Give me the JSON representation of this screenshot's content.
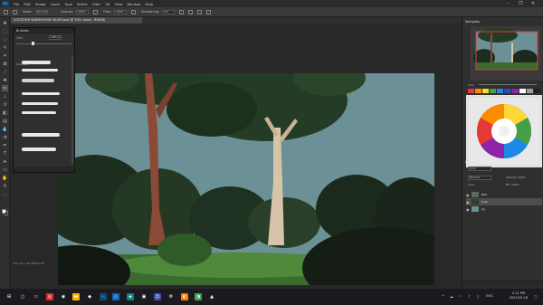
{
  "menubar": {
    "app_logo": "Ps",
    "items": [
      "File",
      "Edit",
      "Image",
      "Layer",
      "Type",
      "Select",
      "Filter",
      "3D",
      "View",
      "Window",
      "Help"
    ],
    "window_controls": {
      "minimize": "–",
      "maximize": "❐",
      "close": "✕"
    }
  },
  "options": {
    "mode_label": "Mode:",
    "mode_value": "Normal",
    "opacity_label": "Opacity:",
    "opacity_value": "100%",
    "flow_label": "Flow:",
    "flow_value": "100%",
    "smoothing_label": "Smoothing:",
    "smoothing_value": "0%"
  },
  "document": {
    "tab_title": "LOCATION WAREHOUSE BUSH.psd @ 33% (bush, RGB/8)",
    "status": "33%   Doc: 20.3M/20.3M"
  },
  "brush_panel": {
    "title": "Brushes",
    "size_label": "Size:",
    "size_value": "196 px",
    "group_label": "brushes 2",
    "stroke_count": 9
  },
  "right_panels": {
    "navigator_title": "Navigator",
    "zoom": "33%",
    "layers_title": "Layers",
    "kind_label": "Kind",
    "blend_mode": "Normal",
    "opacity": "Opacity: 100%",
    "lock_label": "Lock:",
    "fill": "Fill: 100%",
    "layers": [
      {
        "name": "BKG",
        "thumb_color": "#5b6b5e",
        "selected": false
      },
      {
        "name": "bush",
        "thumb_color": "#2c3d2b",
        "selected": true
      },
      {
        "name": "bg",
        "thumb_color": "#6a9094",
        "selected": false
      }
    ],
    "swatches": [
      "#e53935",
      "#fb8c00",
      "#fdd835",
      "#43a047",
      "#1e88e5",
      "#3949ab",
      "#8e24aa",
      "#ffffff",
      "#9e9e9e",
      "#212121"
    ]
  },
  "taskbar": {
    "time": "2:11 PM",
    "date": "2023-05-18",
    "lang": "ENG",
    "tray_up": "^"
  },
  "colors": {
    "sky": "#6b9095",
    "foliage_dark": "#1f2d1f",
    "foliage_mid": "#2f4a2c",
    "grass": "#4e8a3a",
    "trunk_left": "#8a4a36",
    "trunk_right": "#d8c4a8",
    "accent": "#31a8ff"
  }
}
